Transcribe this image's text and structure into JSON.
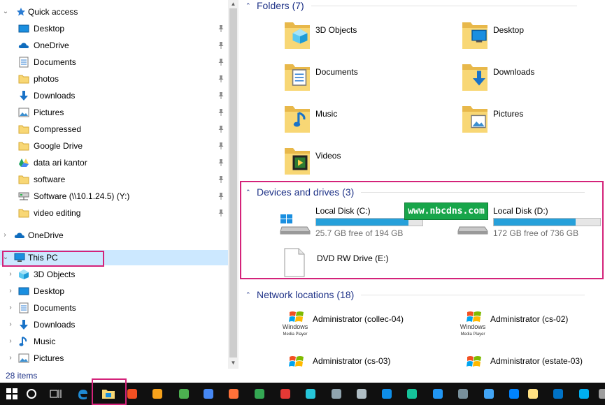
{
  "sidebar": {
    "quick_access_label": "Quick access",
    "quick_items": [
      {
        "label": "Desktop",
        "icon": "desktop-icon"
      },
      {
        "label": "OneDrive",
        "icon": "onedrive-icon"
      },
      {
        "label": "Documents",
        "icon": "documents-icon"
      },
      {
        "label": "photos",
        "icon": "folder-icon"
      },
      {
        "label": "Downloads",
        "icon": "downloads-icon"
      },
      {
        "label": "Pictures",
        "icon": "pictures-icon"
      },
      {
        "label": "Compressed",
        "icon": "folder-icon"
      },
      {
        "label": "Google Drive",
        "icon": "folder-icon"
      },
      {
        "label": "data ari kantor",
        "icon": "google-drive-icon"
      },
      {
        "label": "software",
        "icon": "folder-icon"
      },
      {
        "label": "Software (\\\\10.1.24.5) (Y:)",
        "icon": "network-drive-icon"
      },
      {
        "label": "video editing",
        "icon": "folder-icon"
      }
    ],
    "onedrive_label": "OneDrive",
    "this_pc_label": "This PC",
    "pc_items": [
      {
        "label": "3D Objects",
        "icon": "3d-objects-icon"
      },
      {
        "label": "Desktop",
        "icon": "desktop-icon"
      },
      {
        "label": "Documents",
        "icon": "documents-icon"
      },
      {
        "label": "Downloads",
        "icon": "downloads-icon"
      },
      {
        "label": "Music",
        "icon": "music-icon"
      },
      {
        "label": "Pictures",
        "icon": "pictures-icon"
      }
    ]
  },
  "main": {
    "folders_header": "Folders (7)",
    "folders": [
      {
        "label": "3D Objects"
      },
      {
        "label": "Desktop"
      },
      {
        "label": "Documents"
      },
      {
        "label": "Downloads"
      },
      {
        "label": "Music"
      },
      {
        "label": "Pictures"
      },
      {
        "label": "Videos"
      }
    ],
    "devices_header": "Devices and drives (3)",
    "drives": [
      {
        "label": "Local Disk (C:)",
        "free": "25.7 GB free of 194 GB",
        "used_fraction": 0.87
      },
      {
        "label": "Local Disk (D:)",
        "free": "172 GB free of 736 GB",
        "used_fraction": 0.77
      }
    ],
    "dvd_label": "DVD RW Drive (E:)",
    "network_header": "Network locations (18)",
    "network": [
      {
        "label": "Administrator (collec-04)"
      },
      {
        "label": "Administrator (cs-02)"
      },
      {
        "label": "Administrator (cs-03)"
      },
      {
        "label": "Administrator (estate-03)"
      }
    ],
    "wmp_text": "Windows",
    "wmp_sub": "Media Player"
  },
  "watermark": "www.nbcdns.com",
  "status": {
    "items": "28 items"
  },
  "colors": {
    "accent": "#26a0da",
    "highlight": "#d4237a",
    "header": "#1e3287"
  }
}
